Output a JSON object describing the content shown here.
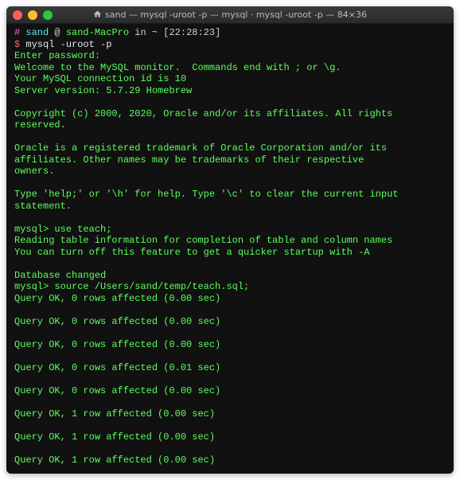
{
  "titlebar": {
    "icon": "home-icon",
    "title": "sand — mysql -uroot -p — mysql · mysql -uroot -p — 84×36"
  },
  "prompt": {
    "hash": "#",
    "user": "sand",
    "at": "@",
    "host": "sand-MacPro",
    "in": "in",
    "dir": "~",
    "time": "[22:28:23]",
    "dollar": "$"
  },
  "cmd1": "mysql -uroot -p",
  "banner": [
    "Enter password:",
    "Welcome to the MySQL monitor.  Commands end with ; or \\g.",
    "Your MySQL connection id is 10",
    "Server version: 5.7.29 Homebrew"
  ],
  "copyright": "Copyright (c) 2000, 2020, Oracle and/or its affiliates. All rights reserved.",
  "trademark": [
    "Oracle is a registered trademark of Oracle Corporation and/or its",
    "affiliates. Other names may be trademarks of their respective",
    "owners."
  ],
  "help": "Type 'help;' or '\\h' for help. Type '\\c' to clear the current input statement.",
  "mysql_prompt": "mysql>",
  "cmd2": "use teach;",
  "use_out": [
    "Reading table information for completion of table and column names",
    "You can turn off this feature to get a quicker startup with -A"
  ],
  "db_changed": "Database changed",
  "cmd3": "source /Users/sand/temp/teach.sql;",
  "queries": [
    "Query OK, 0 rows affected (0.00 sec)",
    "Query OK, 0 rows affected (0.00 sec)",
    "Query OK, 0 rows affected (0.00 sec)",
    "Query OK, 0 rows affected (0.01 sec)",
    "Query OK, 0 rows affected (0.00 sec)",
    "Query OK, 1 row affected (0.00 sec)",
    "Query OK, 1 row affected (0.00 sec)",
    "Query OK, 1 row affected (0.00 sec)"
  ]
}
